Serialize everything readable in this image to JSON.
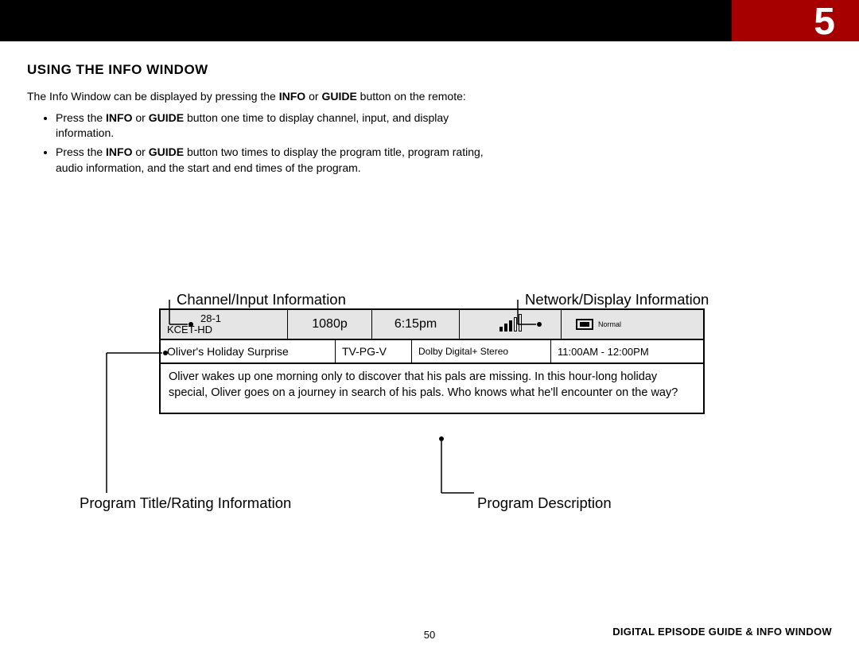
{
  "page_number_top": "5",
  "heading": "USING THE INFO WINDOW",
  "intro_part1": "The Info Window can be displayed by pressing the ",
  "intro_bold1": "INFO",
  "intro_mid1": " or ",
  "intro_bold2": "GUIDE",
  "intro_part2": " button on the remote:",
  "bullet1_a": "Press the ",
  "bullet1_b": " button one time to display channel, input, and display information.",
  "bullet2_a": "Press the ",
  "bullet2_b": " button two times to display the program title, program rating, audio information, and the start and end times of the program.",
  "labels": {
    "tl": "Channel/Input Information",
    "tr": "Network/Display Information",
    "bl": "Program Title/Rating Information",
    "br": "Program Description"
  },
  "info": {
    "channel_num": "28-1",
    "channel_name": "KCET-HD",
    "resolution": "1080p",
    "time": "6:15pm",
    "aspect": "Normal",
    "title": "Oliver's Holiday Surprise",
    "rating": "TV-PG-V",
    "audio": "Dolby Digital+ Stereo",
    "schedule": "11:00AM - 12:00PM",
    "description": "Oliver wakes up one morning only to discover that his pals are missing. In this hour-long holiday special, Oliver goes on a journey in search of his pals. Who knows what he'll encounter on the way?"
  },
  "footer": "DIGITAL EPISODE GUIDE & INFO WINDOW",
  "footer_page": "50"
}
